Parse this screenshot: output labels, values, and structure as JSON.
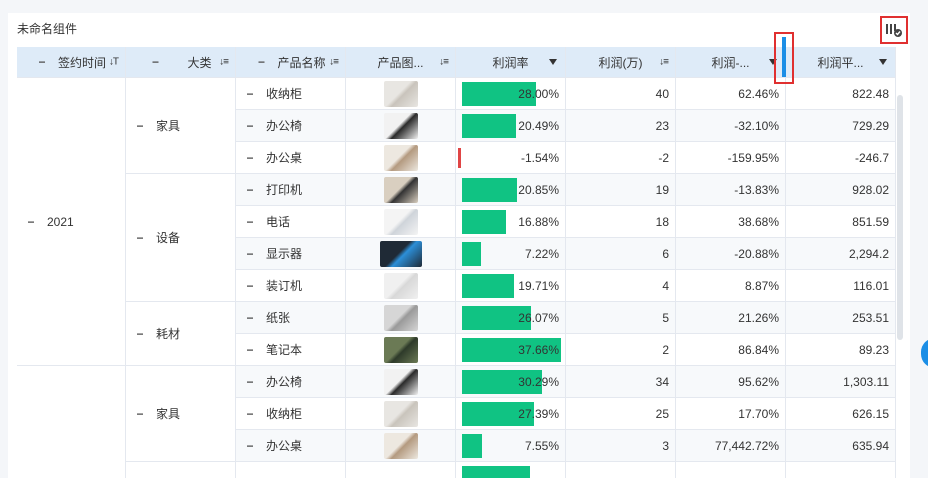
{
  "component_title": "未命名组件",
  "headers": {
    "sign_time": "签约时间",
    "category": "大类",
    "product_name": "产品名称",
    "product_image": "产品图...",
    "profit_rate": "利润率",
    "profit": "利润(万)",
    "profit_growth": "利润-...",
    "profit_avg": "利润平..."
  },
  "icons": {
    "collapse": "−",
    "sort_desc_filter": "↓T",
    "sort_list": "↓≡"
  },
  "groups": {
    "year": "2021",
    "categories": [
      "家具",
      "设备",
      "耗材",
      "家具"
    ]
  },
  "rows": [
    {
      "product": "收纳柜",
      "image": "cabinet",
      "rate": "28.00%",
      "rate_value": 0.28,
      "profit": "40",
      "growth": "62.46%",
      "avg": "822.48"
    },
    {
      "product": "办公椅",
      "image": "chair",
      "rate": "20.49%",
      "rate_value": 0.2049,
      "profit": "23",
      "growth": "-32.10%",
      "avg": "729.29"
    },
    {
      "product": "办公桌",
      "image": "desk",
      "rate": "-1.54%",
      "rate_value": -0.0154,
      "profit": "-2",
      "growth": "-159.95%",
      "avg": "-246.7"
    },
    {
      "product": "打印机",
      "image": "printer",
      "rate": "20.85%",
      "rate_value": 0.2085,
      "profit": "19",
      "growth": "-13.83%",
      "avg": "928.02"
    },
    {
      "product": "电话",
      "image": "phone",
      "rate": "16.88%",
      "rate_value": 0.1688,
      "profit": "18",
      "growth": "38.68%",
      "avg": "851.59"
    },
    {
      "product": "显示器",
      "image": "monitor",
      "rate": "7.22%",
      "rate_value": 0.0722,
      "profit": "6",
      "growth": "-20.88%",
      "avg": "2,294.2"
    },
    {
      "product": "装订机",
      "image": "binder",
      "rate": "19.71%",
      "rate_value": 0.1971,
      "profit": "4",
      "growth": "8.87%",
      "avg": "116.01"
    },
    {
      "product": "纸张",
      "image": "paper",
      "rate": "26.07%",
      "rate_value": 0.2607,
      "profit": "5",
      "growth": "21.26%",
      "avg": "253.51"
    },
    {
      "product": "笔记本",
      "image": "notebook",
      "rate": "37.66%",
      "rate_value": 0.3766,
      "profit": "2",
      "growth": "86.84%",
      "avg": "89.23"
    },
    {
      "product": "办公椅",
      "image": "chair",
      "rate": "30.29%",
      "rate_value": 0.3029,
      "profit": "34",
      "growth": "95.62%",
      "avg": "1,303.11"
    },
    {
      "product": "收纳柜",
      "image": "cabinet",
      "rate": "27.39%",
      "rate_value": 0.2739,
      "profit": "25",
      "growth": "17.70%",
      "avg": "626.15"
    },
    {
      "product": "办公桌",
      "image": "desk",
      "rate": "7.55%",
      "rate_value": 0.0755,
      "profit": "3",
      "growth": "77,442.72%",
      "avg": "635.94"
    },
    {
      "product": "",
      "image": "",
      "rate": "",
      "rate_value": 0.26,
      "profit": "",
      "growth": "",
      "avg": ""
    }
  ],
  "colors": {
    "header_bg": "#deebf8",
    "bar_positive": "#10c383",
    "bar_negative": "#e04545",
    "highlight_border": "#e03030",
    "accent_blue": "#1b8ee6"
  }
}
